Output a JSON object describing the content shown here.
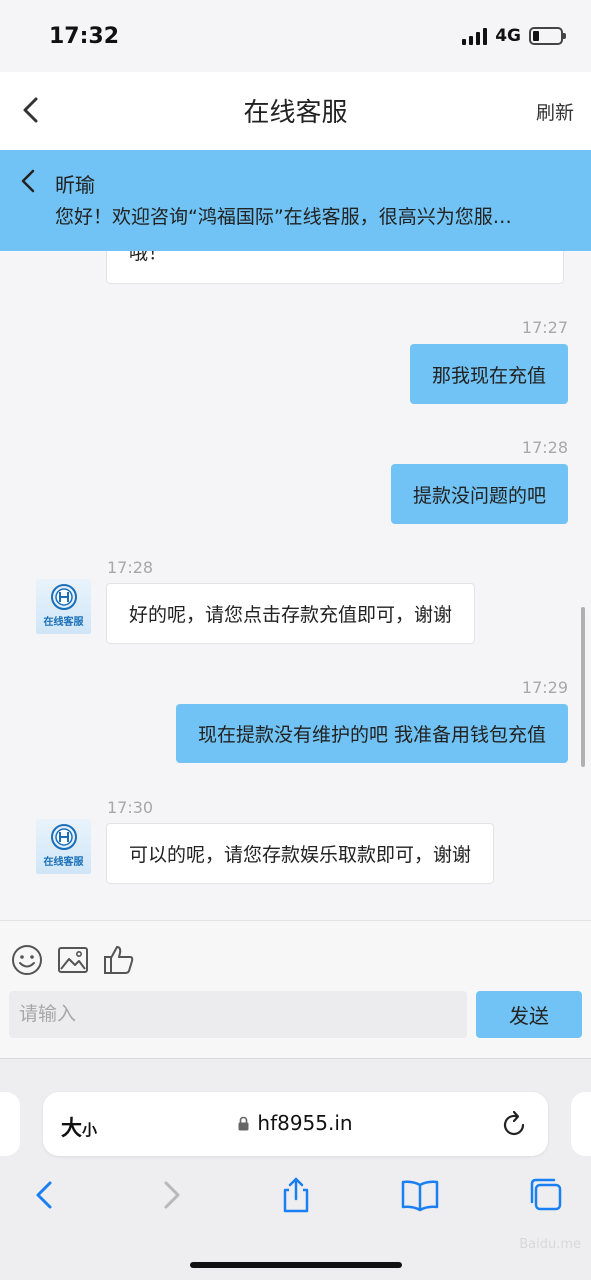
{
  "status_bar": {
    "time": "17:32",
    "network": "4G"
  },
  "header": {
    "title": "在线客服",
    "refresh_label": "刷新"
  },
  "notice": {
    "agent_name": "昕瑜",
    "message": "您好！欢迎咨询“鸿福国际”在线客服，很高兴为您服…"
  },
  "chat": {
    "partial_incoming": "哦！",
    "avatar_label": "在线客服",
    "messages": [
      {
        "time": "17:27",
        "text": "那我现在充值"
      },
      {
        "time": "17:28",
        "text": "提款没问题的吧"
      },
      {
        "time": "17:28",
        "text": "好的呢，请您点击存款充值即可，谢谢"
      },
      {
        "time": "17:29",
        "text": "现在提款没有维护的吧 我准备用钱包充值"
      },
      {
        "time": "17:30",
        "text": "可以的呢，请您存款娱乐取款即可，谢谢"
      }
    ]
  },
  "input": {
    "placeholder": "请输入",
    "send_label": "发送"
  },
  "browser": {
    "text_size_label": "大",
    "text_size_small": "小",
    "url": "hf8955.in"
  },
  "watermark": "Baidu.me",
  "colors": {
    "accent": "#70c3f4",
    "background": "#f5f5f7"
  }
}
